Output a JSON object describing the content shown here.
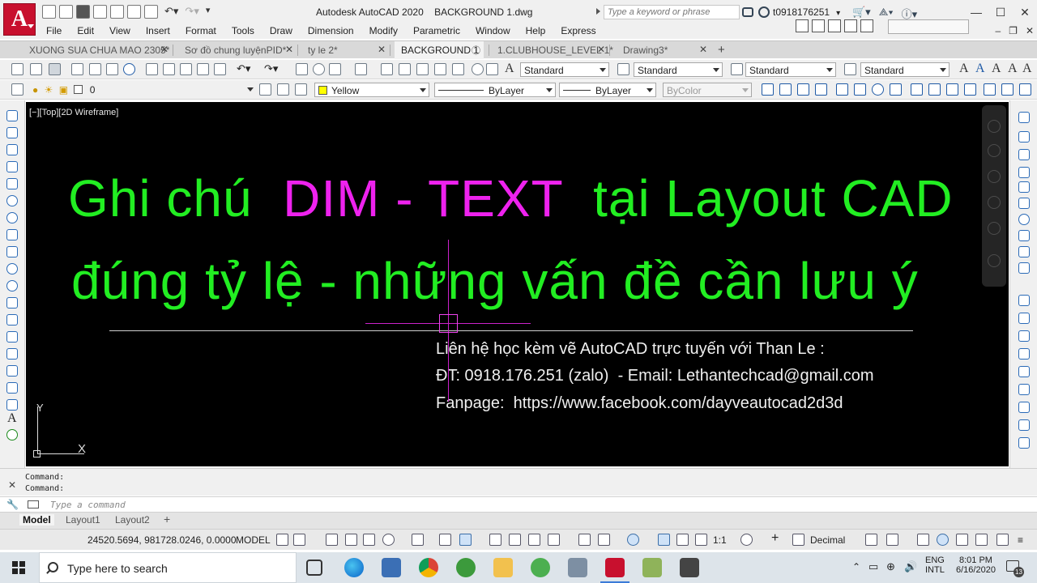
{
  "app": {
    "logo_letter": "A",
    "title": "Autodesk AutoCAD 2020    BACKGROUND 1.dwg",
    "search_placeholder": "Type a keyword or phrase",
    "user": "t0918176251",
    "accent_color": "#c8102e"
  },
  "menu": [
    "File",
    "Edit",
    "View",
    "Insert",
    "Format",
    "Tools",
    "Draw",
    "Dimension",
    "Modify",
    "Parametric",
    "Window",
    "Help",
    "Express"
  ],
  "file_tabs": [
    {
      "label": "XUONG SUA CHUA MAO 2305*",
      "active": false
    },
    {
      "label": "Sơ đồ chung luyệnPID*",
      "active": false
    },
    {
      "label": "ty le 2*",
      "active": false
    },
    {
      "label": "BACKGROUND 1",
      "active": true
    },
    {
      "label": "1.CLUBHOUSE_LEVEL 1*",
      "active": false
    },
    {
      "label": "Drawing3*",
      "active": false
    }
  ],
  "styles_toolbar": {
    "text_style": "Standard",
    "dim_style": "Standard",
    "table_style": "Standard",
    "mleader_style": "Standard"
  },
  "layers_toolbar": {
    "layer": "0",
    "color": "Yellow",
    "color_hex": "#ffff00",
    "linetype": "ByLayer",
    "lineweight": "ByLayer",
    "plotstyle": "ByColor"
  },
  "viewport": {
    "label": "[−][Top][2D Wireframe]",
    "title_part1": "Ghi chú  ",
    "title_highlight": "DIM - TEXT",
    "title_part2": "  tại Layout CAD",
    "title_line2": "đúng tỷ lệ - những vấn đề cần lưu ý",
    "title_color": "#22ee22",
    "highlight_color": "#ee22ee",
    "contact_line1": "Liên hệ học kèm vẽ AutoCAD trực tuyến với Than Le :",
    "contact_line2": "ĐT: 0918.176.251 (zalo)  - Email: Lethantechcad@gmail.com",
    "contact_line3": "Fanpage:  https://www.facebook.com/dayveautocad2d3d",
    "ucs_x": "X",
    "ucs_y": "Y"
  },
  "command": {
    "history": [
      "Command:",
      "Command:"
    ],
    "placeholder": "Type a command"
  },
  "layout_tabs": [
    {
      "label": "Model",
      "active": true
    },
    {
      "label": "Layout1",
      "active": false
    },
    {
      "label": "Layout2",
      "active": false
    }
  ],
  "statusbar": {
    "coords": "24520.5694, 981728.0246, 0.0000",
    "space": "MODEL",
    "scale": "1:1",
    "units": "Decimal"
  },
  "taskbar": {
    "search_text": "Type here to search",
    "lang1": "ENG",
    "lang2": "INTL",
    "time": "8:01 PM",
    "date": "6/16/2020",
    "notifications": "13"
  }
}
